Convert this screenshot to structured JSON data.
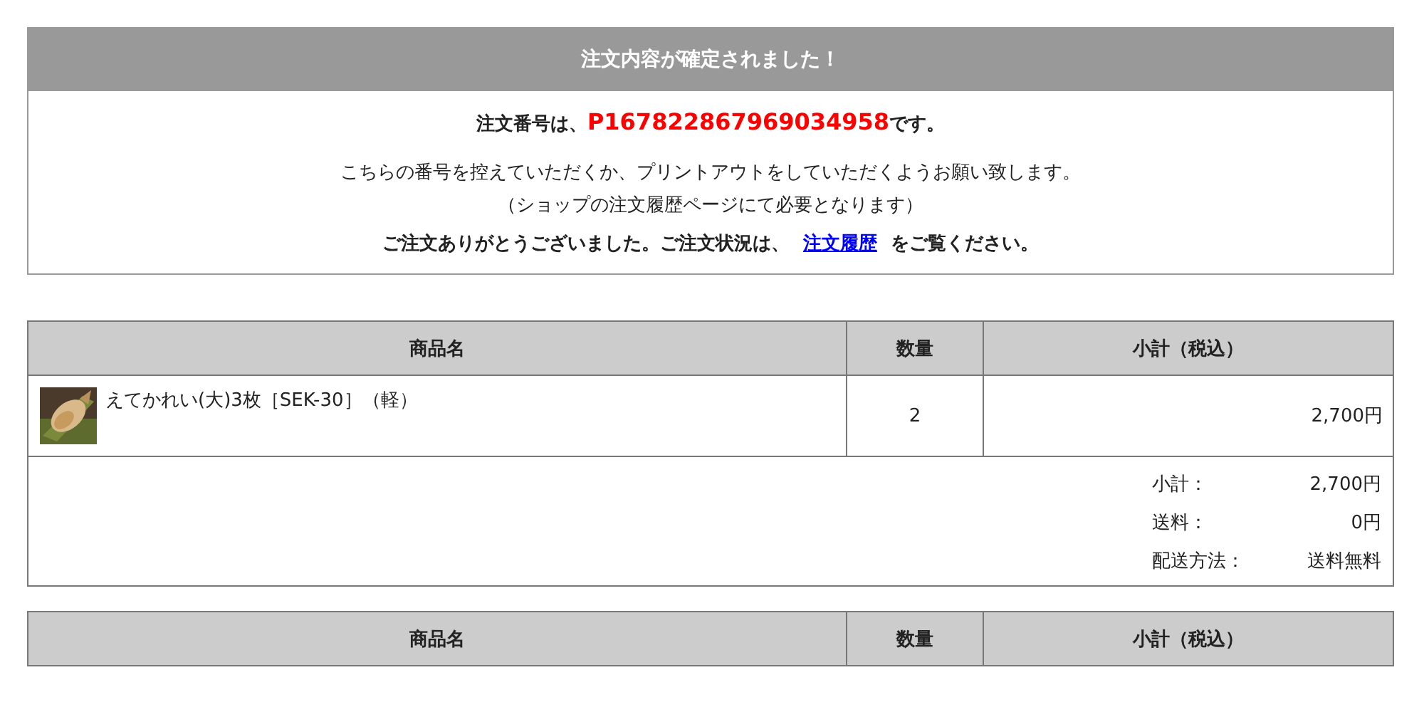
{
  "confirmation": {
    "title": "注文内容が確定されました！",
    "order_prefix": "注文番号は、",
    "order_number": "P167822867969034958",
    "order_suffix": "です。",
    "notes": [
      "こちらの番号を控えていただくか、プリントアウトをしていただくようお願い致します。",
      "（ショップの注文履歴ページにて必要となります）"
    ],
    "thanks_before": "ご注文ありがとうございました。ご注文状況は、",
    "thanks_link": "注文履歴",
    "thanks_after": "をご覧ください。"
  },
  "orders": [
    {
      "columns": [
        "商品名",
        "数量",
        "小計（税込）"
      ],
      "rows": [
        {
          "name": "えてかれい(大)3枚［SEK-30］（軽）",
          "quantity": "2",
          "subtotal": "2,700円"
        }
      ],
      "summary": [
        {
          "label": "小計：",
          "value": "2,700円"
        },
        {
          "label": "送料：",
          "value": "0円"
        },
        {
          "label": "配送方法：",
          "value": "送料無料"
        }
      ]
    },
    {
      "columns": [
        "商品名",
        "数量",
        "小計（税込）"
      ]
    }
  ]
}
